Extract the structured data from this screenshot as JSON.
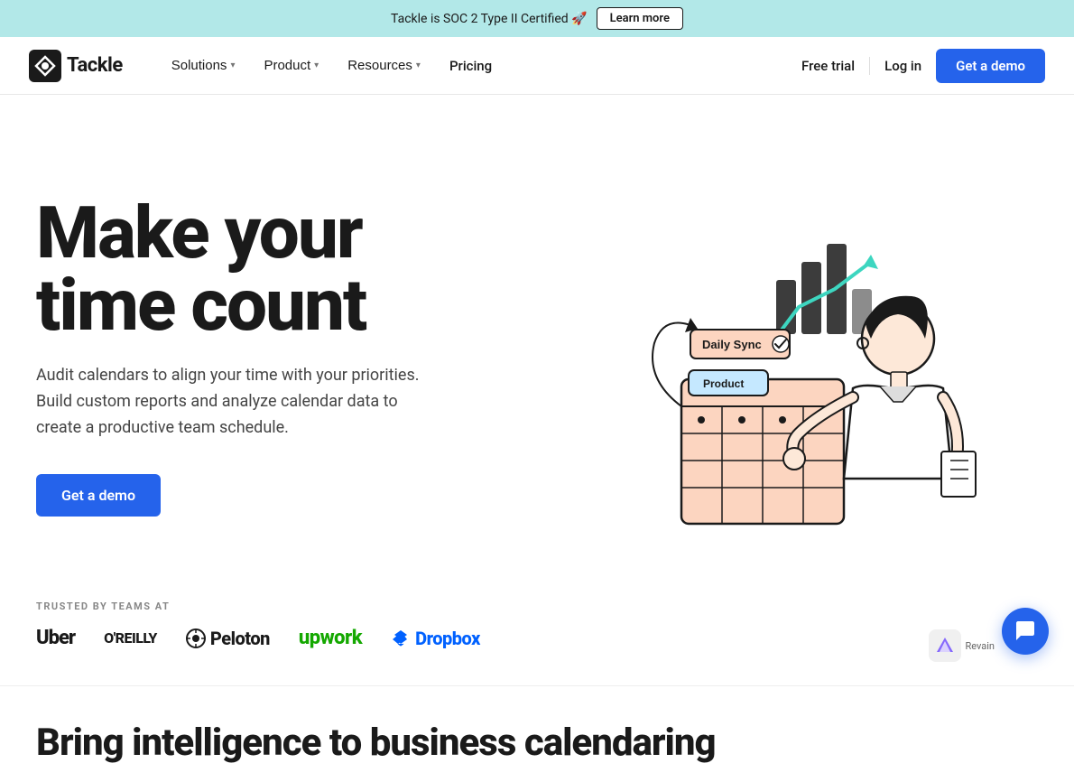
{
  "announcement": {
    "text": "Tackle is SOC 2 Type II Certified 🚀",
    "learn_more_label": "Learn more"
  },
  "navbar": {
    "logo_text": "Tackle",
    "nav_items": [
      {
        "id": "solutions",
        "label": "Solutions",
        "has_dropdown": true
      },
      {
        "id": "product",
        "label": "Product",
        "has_dropdown": true
      },
      {
        "id": "resources",
        "label": "Resources",
        "has_dropdown": true
      },
      {
        "id": "pricing",
        "label": "Pricing",
        "has_dropdown": false
      }
    ],
    "login_label": "Log in",
    "free_trial_label": "Free trial",
    "get_demo_label": "Get a demo"
  },
  "hero": {
    "title_line1": "Make your",
    "title_line2": "time count",
    "subtitle": "Audit calendars to align your time with your priorities. Build custom reports and analyze calendar data to create a productive team schedule.",
    "cta_label": "Get a demo"
  },
  "trusted": {
    "label": "TRUSTED BY TEAMS AT",
    "logos": [
      {
        "id": "uber",
        "name": "Uber"
      },
      {
        "id": "oreilly",
        "name": "O'REILLY"
      },
      {
        "id": "peloton",
        "name": "Peloton"
      },
      {
        "id": "upwork",
        "name": "upwork"
      },
      {
        "id": "dropbox",
        "name": "Dropbox"
      }
    ]
  },
  "bottom_teaser": {
    "text": "Bring intelligence to business calendaring"
  },
  "chat": {
    "label": "Chat support"
  },
  "revain": {
    "label": "Revain"
  },
  "colors": {
    "accent_blue": "#2563eb",
    "announcement_bg": "#b2e8e8"
  }
}
